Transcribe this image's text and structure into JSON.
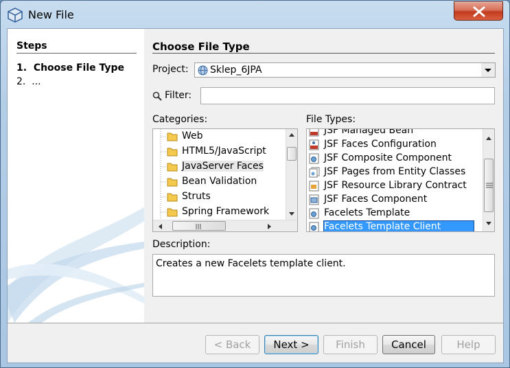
{
  "window": {
    "title": "New File"
  },
  "steps": {
    "title": "Steps",
    "items": [
      {
        "num": "1.",
        "label": "Choose File Type"
      },
      {
        "num": "2.",
        "label": "..."
      }
    ]
  },
  "main": {
    "heading": "Choose File Type",
    "project_label": "Project:",
    "project_value": "Sklep_6JPA",
    "filter_label": "Filter:",
    "filter_value": "",
    "categories_label": "Categories:",
    "categories": [
      "Web",
      "HTML5/JavaScript",
      "JavaServer Faces",
      "Bean Validation",
      "Struts",
      "Spring Framework"
    ],
    "selected_category": "JavaServer Faces",
    "file_types_label": "File Types:",
    "file_types": [
      "JSF Managed Bean",
      "JSF Faces Configuration",
      "JSF Composite Component",
      "JSF Pages from Entity Classes",
      "JSF Resource Library Contract",
      "JSF Faces Component",
      "Facelets Template",
      "Facelets Template Client"
    ],
    "selected_file_type": "Facelets Template Client",
    "description_label": "Description:",
    "description": "Creates a new Facelets template client."
  },
  "buttons": {
    "back": "< Back",
    "next": "Next >",
    "finish": "Finish",
    "cancel": "Cancel",
    "help": "Help"
  },
  "colors": {
    "selection": "#3399ff",
    "window_frame": "#b3cde6",
    "close_button": "#c23b1f"
  }
}
